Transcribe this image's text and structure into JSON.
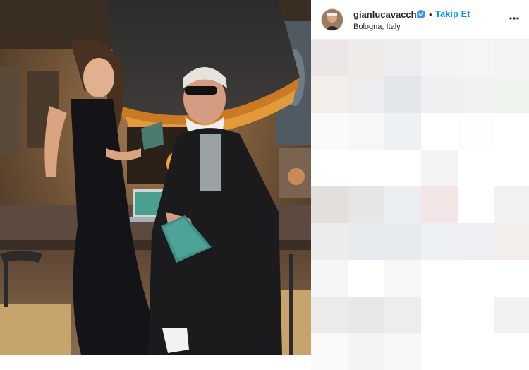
{
  "post": {
    "username": "gianlucavacchi",
    "follow_label": "Takip Et",
    "separator": "•",
    "location": "Bologna, Italy",
    "photo_alt": "",
    "verified": true
  },
  "icons": {
    "verified": "verified-badge-icon",
    "more": "more-options-icon"
  },
  "colors": {
    "link_blue": "#0095f6",
    "text": "#262626",
    "verified_blue": "#3897f0"
  },
  "pixelated_comments": {
    "tiles": [
      "#ebe6e5",
      "#efebe9",
      "#ecedef",
      "#f2f4f6",
      "#f3f5f7",
      "#f3f3f3",
      "#f3eeea",
      "#ebedef",
      "#e3e6ea",
      "#eef0f1",
      "#f1f1f1",
      "#eef4ee",
      "#fafafa",
      "#f5f7f9",
      "#eef1f4",
      "#ffffff",
      "#fdfdfd",
      "#ffffff",
      "#ffffff",
      "#ffffff",
      "#ffffff",
      "#f4f4f4",
      "#ffffff",
      "#ffffff",
      "#e3dfdc",
      "#e6e6e6",
      "#eceff1",
      "#f4e6e6",
      "#ffffff",
      "#f2f2f2",
      "#ececec",
      "#e7eaee",
      "#e8ebee",
      "#eef1f4",
      "#eeeff2",
      "#f3eeea",
      "#f6f6f6",
      "#ffffff",
      "#f7f7f7",
      "#ffffff",
      "#ffffff",
      "#ffffff",
      "#ebebeb",
      "#e8e8e8",
      "#ededed",
      "#ffffff",
      "#ffffff",
      "#f1f1f1",
      "#fafafa",
      "#f4f4f4",
      "#f7f7f7",
      "#ffffff",
      "#ffffff",
      "#ffffff"
    ]
  }
}
